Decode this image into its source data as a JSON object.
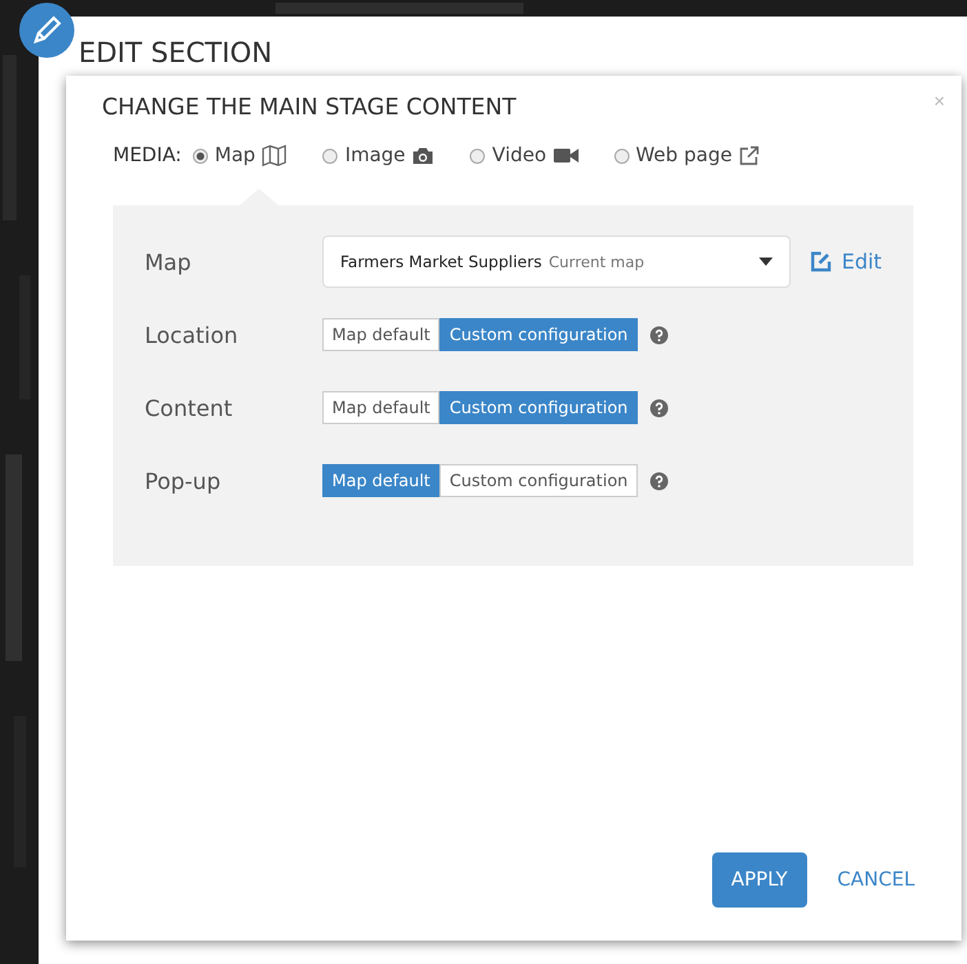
{
  "page": {
    "title": "EDIT SECTION"
  },
  "dialog": {
    "title": "CHANGE THE MAIN STAGE CONTENT",
    "close": "×"
  },
  "media": {
    "label": "MEDIA:",
    "options": [
      {
        "label": "Map",
        "kind": "map",
        "selected": true
      },
      {
        "label": "Image",
        "selected": false
      },
      {
        "label": "Video",
        "kind": "video",
        "selected": false
      },
      {
        "label": "Web page",
        "kind": "webpage",
        "selected": false
      }
    ]
  },
  "map_field": {
    "label": "Map",
    "value": "Farmers Market Suppliers",
    "note": "Current map",
    "edit": "Edit"
  },
  "settings": [
    {
      "label": "Location",
      "options": [
        {
          "label": "Map default",
          "selected": false
        },
        {
          "label": "Custom configuration",
          "selected": true
        }
      ]
    },
    {
      "label": "Content",
      "options": [
        {
          "label": "Map default",
          "selected": false
        },
        {
          "label": "Custom configuration",
          "selected": true
        }
      ]
    },
    {
      "label": "Pop-up",
      "options": [
        {
          "label": "Map default",
          "selected": true
        },
        {
          "label": "Custom configuration",
          "selected": false
        }
      ]
    }
  ],
  "buttons": {
    "apply": "APPLY",
    "cancel": "CANCEL"
  }
}
